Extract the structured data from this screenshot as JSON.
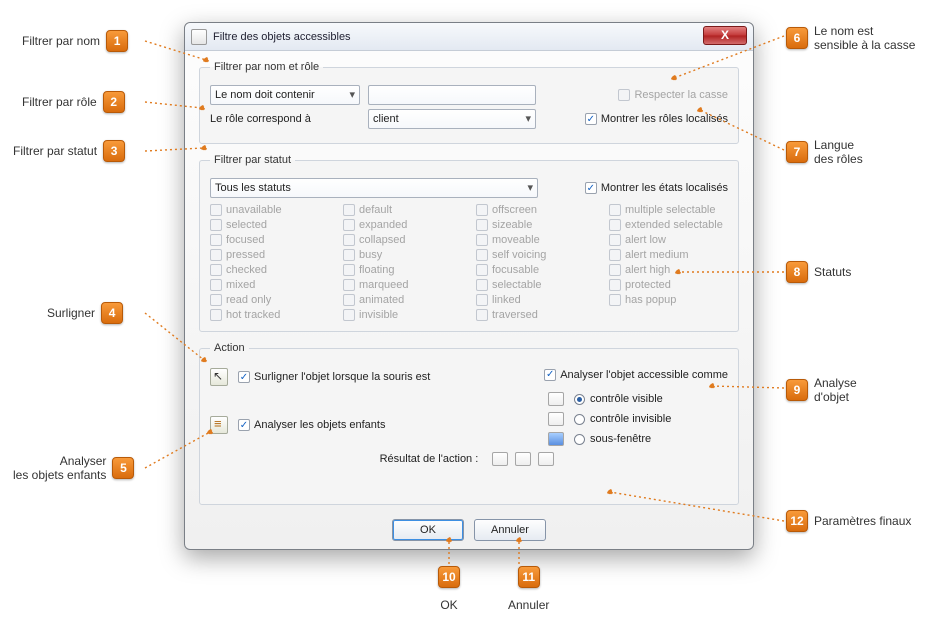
{
  "window": {
    "title": "Filtre des objets accessibles",
    "close_symbol": "X"
  },
  "groups": {
    "name_role": {
      "legend": "Filtrer par nom et rôle",
      "name_mode": "Le nom doit contenir",
      "name_value": "",
      "case_label": "Respecter la casse",
      "role_label": "Le rôle correspond à",
      "role_value": "client",
      "show_localized_roles": "Montrer les rôles localisés"
    },
    "status": {
      "legend": "Filtrer par statut",
      "all_label": "Tous les statuts",
      "show_localized_states": "Montrer les états localisés",
      "col1": [
        "unavailable",
        "selected",
        "focused",
        "pressed",
        "checked",
        "mixed",
        "read only",
        "hot tracked"
      ],
      "col2": [
        "default",
        "expanded",
        "collapsed",
        "busy",
        "floating",
        "marqueed",
        "animated",
        "invisible"
      ],
      "col3": [
        "offscreen",
        "sizeable",
        "moveable",
        "self voicing",
        "focusable",
        "selectable",
        "linked",
        "traversed"
      ],
      "col4": [
        "multiple selectable",
        "extended selectable",
        "alert low",
        "alert medium",
        "alert high",
        "protected",
        "has popup"
      ]
    },
    "action": {
      "legend": "Action",
      "highlight": "Surligner l'objet lorsque la souris est",
      "analyze_children": "Analyser les objets enfants",
      "analyze_as": "Analyser l'objet accessible comme",
      "options": [
        "contrôle visible",
        "contrôle invisible",
        "sous-fenêtre"
      ],
      "result_label": "Résultat de l'action :"
    }
  },
  "buttons": {
    "ok": "OK",
    "cancel": "Annuler"
  },
  "callouts": {
    "1": "Filtrer par nom",
    "2": "Filtrer par rôle",
    "3": "Filtrer par statut",
    "4": "Surligner",
    "5": "Analyser\nles objets enfants",
    "6": "Le nom est\nsensible à la casse",
    "7": "Langue\ndes rôles",
    "8": "Statuts",
    "9": "Analyse\nd'objet",
    "10": "OK",
    "11": "Annuler",
    "12": "Paramètres finaux"
  }
}
